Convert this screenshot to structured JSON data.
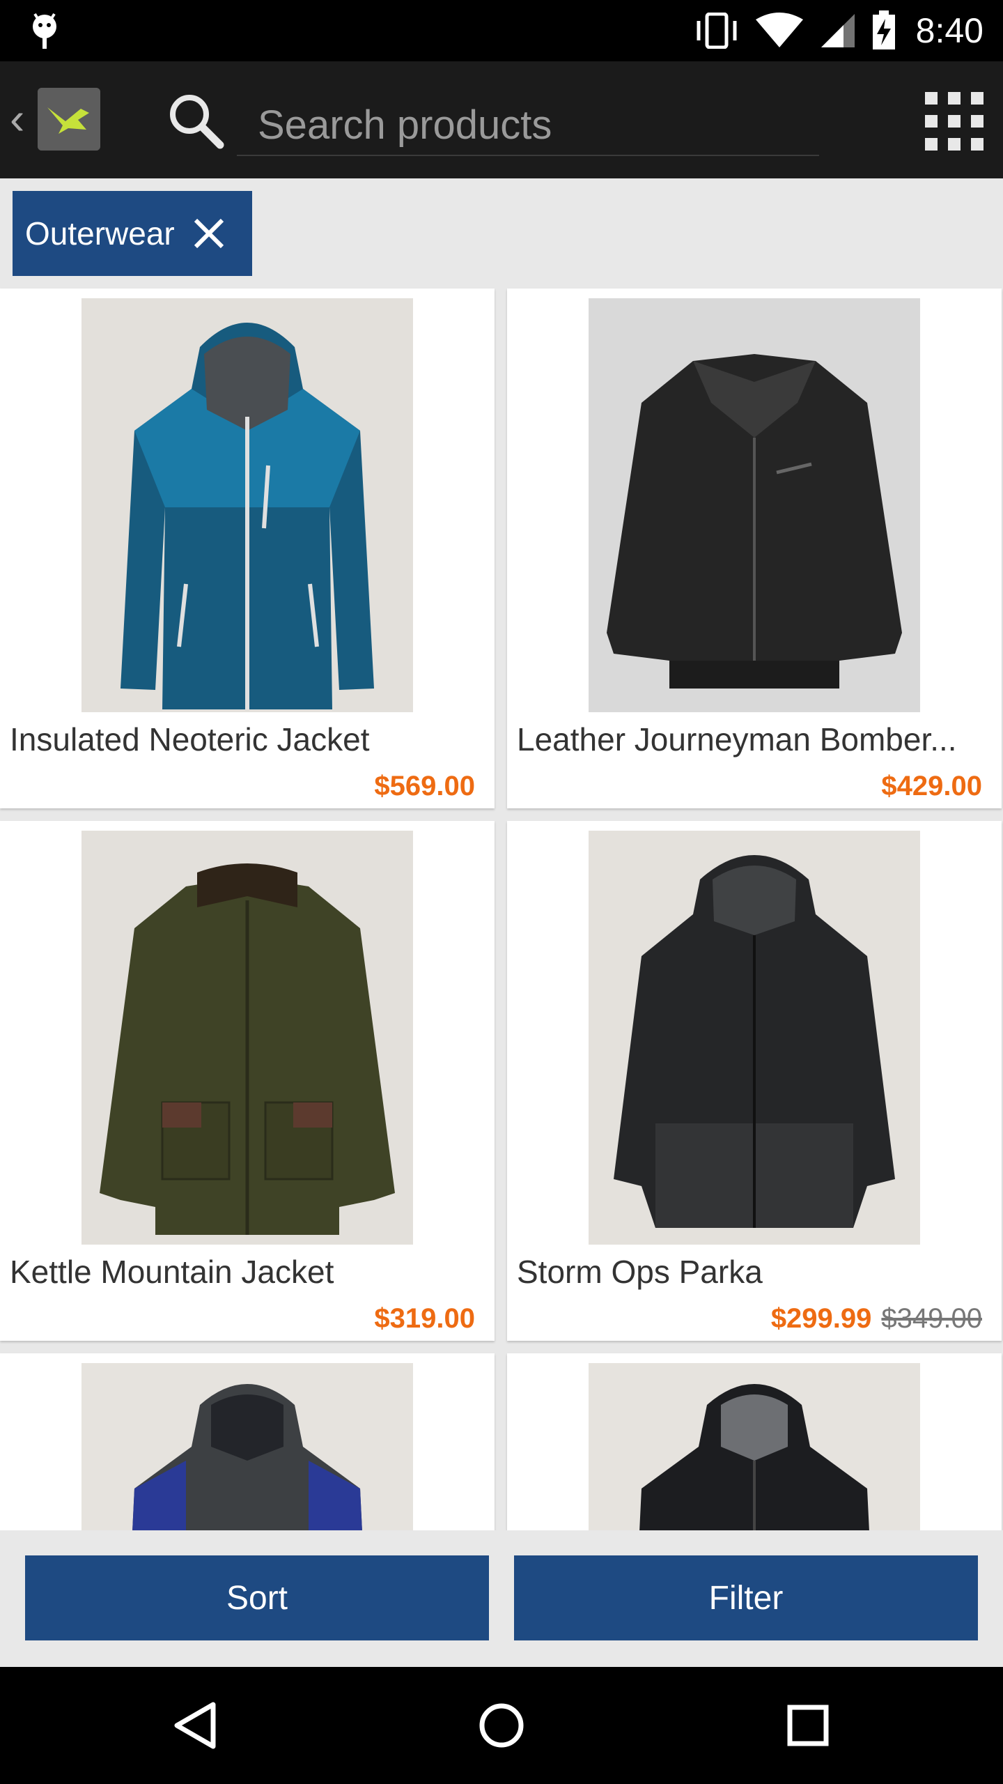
{
  "status_bar": {
    "time": "8:40"
  },
  "app_bar": {
    "search": {
      "placeholder": "Search products",
      "value": ""
    }
  },
  "filter_chip": {
    "label": "Outerwear"
  },
  "products": [
    {
      "name": "Insulated Neoteric Jacket",
      "price": "$569.00",
      "original_price": ""
    },
    {
      "name": "Leather Journeyman Bomber...",
      "price": "$429.00",
      "original_price": ""
    },
    {
      "name": "Kettle Mountain Jacket",
      "price": "$319.00",
      "original_price": ""
    },
    {
      "name": "Storm Ops Parka",
      "price": "$299.99",
      "original_price": "$349.00"
    }
  ],
  "actions": {
    "sort_label": "Sort",
    "filter_label": "Filter"
  },
  "colors": {
    "brand_blue": "#1e4a82",
    "price_orange": "#ee6b12",
    "app_bar": "#1b1b1b"
  }
}
